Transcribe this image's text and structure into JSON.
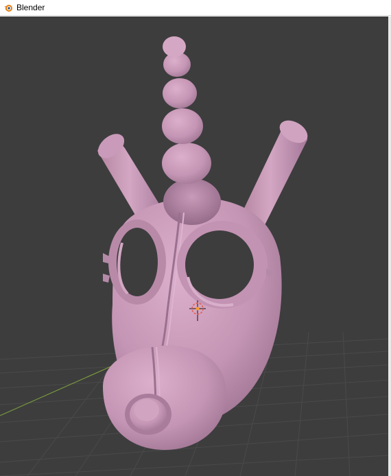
{
  "window": {
    "title": "Blender",
    "icon": "blender-logo-icon"
  },
  "viewport": {
    "background": "#3d3d3d",
    "model_color": "#c99ab9",
    "grid_color": "#4a4a4a",
    "x_axis_color": "#7a9a3e",
    "origin_marker": "object-origin-icon"
  }
}
